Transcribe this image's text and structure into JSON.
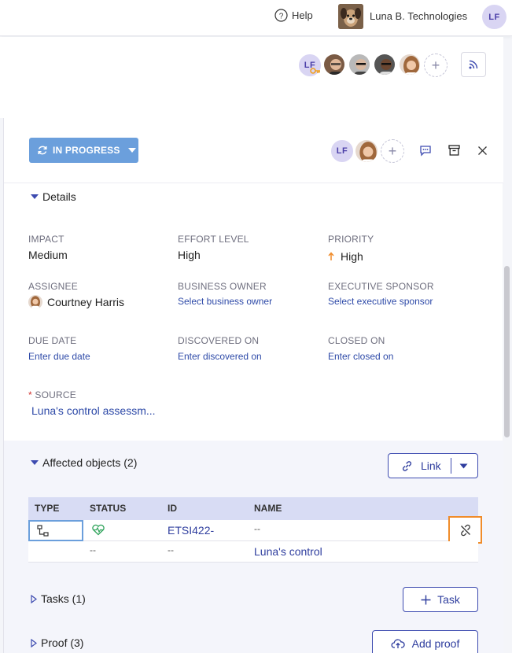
{
  "topbar": {
    "help_label": "Help",
    "org_name": "Luna B. Technologies",
    "user_initials": "LF"
  },
  "watchers": {
    "owner_initials": "LF"
  },
  "panel": {
    "status_label": "IN PROGRESS",
    "assignee_initials": "LF"
  },
  "details": {
    "title": "Details",
    "impact_label": "IMPACT",
    "impact_value": "Medium",
    "effort_label": "EFFORT LEVEL",
    "effort_value": "High",
    "priority_label": "PRIORITY",
    "priority_value": "High",
    "assignee_label": "ASSIGNEE",
    "assignee_value": "Courtney Harris",
    "business_owner_label": "BUSINESS OWNER",
    "business_owner_value": "Select business owner",
    "exec_sponsor_label": "EXECUTIVE SPONSOR",
    "exec_sponsor_value": "Select executive sponsor",
    "due_date_label": "DUE DATE",
    "due_date_value": "Enter due date",
    "discovered_label": "DISCOVERED ON",
    "discovered_value": "Enter discovered on",
    "closed_label": "CLOSED ON",
    "closed_value": "Enter closed on",
    "source_required": "*",
    "source_label": "SOURCE",
    "source_value": "Luna's control assessm..."
  },
  "affected": {
    "title": "Affected objects (2)",
    "link_button": "Link",
    "columns": [
      "TYPE",
      "STATUS",
      "ID",
      "NAME"
    ],
    "row1": {
      "id": "ETSI422-",
      "name": "--"
    },
    "row2": {
      "status": "--",
      "id": "--",
      "name": "Luna's control"
    }
  },
  "tasks": {
    "title": "Tasks (1)",
    "button": "Task"
  },
  "proof": {
    "title": "Proof (3)",
    "button": "Add proof"
  },
  "colors": {
    "accent": "#3d4bb0",
    "status_button": "#6b9fdc",
    "priority_arrow": "#f08c2a",
    "highlight": "#f08c2a",
    "avatar_bg": "#d9d5f3"
  }
}
